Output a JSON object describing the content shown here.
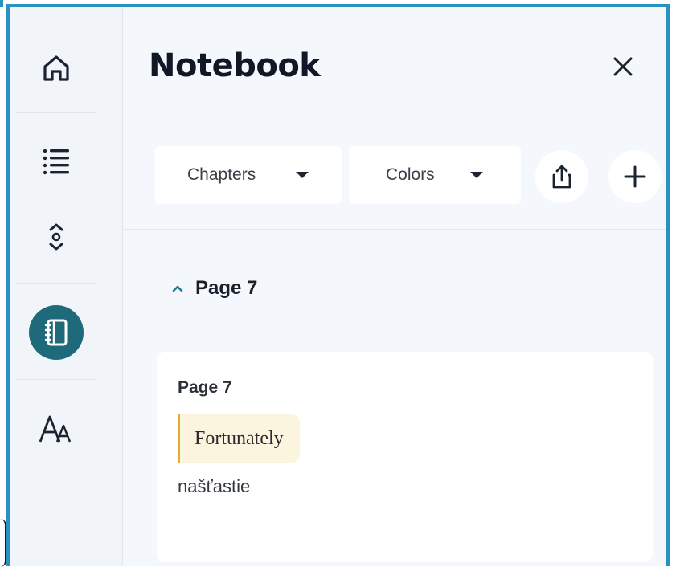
{
  "window": {
    "title": "Notebook"
  },
  "rail": {
    "items": [
      {
        "name": "home-icon"
      },
      {
        "name": "list-icon"
      },
      {
        "name": "scroll-position-icon"
      },
      {
        "name": "notebook-icon",
        "active": true
      },
      {
        "name": "font-size-icon"
      }
    ]
  },
  "toolbar": {
    "chapters_label": "Chapters",
    "colors_label": "Colors"
  },
  "section": {
    "label": "Page 7",
    "expanded": true
  },
  "card": {
    "title": "Page 7",
    "highlight_text": "Fortunately",
    "translation": "našťastie",
    "highlight_color": "#e3ac34"
  },
  "colors": {
    "accent": "#1f6a7a",
    "frame": "#2a91c0",
    "highlight_bg": "#fbf4df"
  }
}
